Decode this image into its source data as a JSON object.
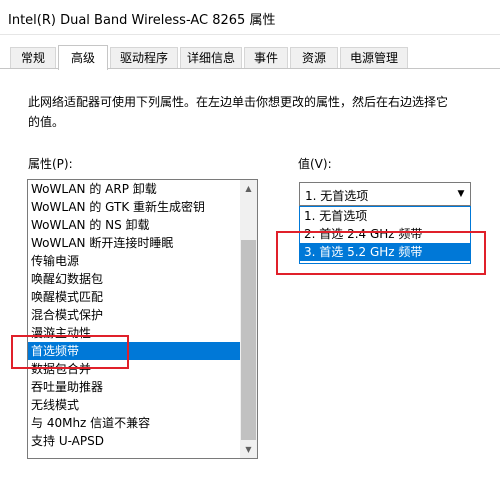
{
  "window": {
    "title": "Intel(R) Dual Band Wireless-AC 8265 属性"
  },
  "tabs": [
    {
      "label": "常规"
    },
    {
      "label": "高级"
    },
    {
      "label": "驱动程序"
    },
    {
      "label": "详细信息"
    },
    {
      "label": "事件"
    },
    {
      "label": "资源"
    },
    {
      "label": "电源管理"
    }
  ],
  "active_tab": "高级",
  "description": "此网络适配器可使用下列属性。在左边单击你想更改的属性，然后在右边选择它的值。",
  "property_label": "属性(P):",
  "value_label": "值(V):",
  "properties": [
    "WoWLAN 的 ARP 卸载",
    "WoWLAN 的 GTK 重新生成密钥",
    "WoWLAN 的 NS 卸载",
    "WoWLAN 断开连接时睡眠",
    "传输电源",
    "唤醒幻数据包",
    "唤醒模式匹配",
    "混合模式保护",
    "漫游主动性",
    "首选频带",
    "数据包合并",
    "吞吐量助推器",
    "无线模式",
    "与 40Mhz 信道不兼容",
    "支持 U-APSD"
  ],
  "selected_property": "首选频带",
  "value_combo": {
    "selected": "1. 无首选项"
  },
  "value_options": [
    "1. 无首选项",
    "2. 首选 2.4 GHz 频带",
    "3. 首选 5.2 GHz 频带"
  ],
  "highlighted_option": "3. 首选 5.2 GHz 频带",
  "colors": {
    "selection": "#0078d7",
    "annotation": "#e0202a"
  },
  "icons": {
    "scroll_up": "▲",
    "scroll_down": "▼",
    "combo_arrow": "▼"
  }
}
